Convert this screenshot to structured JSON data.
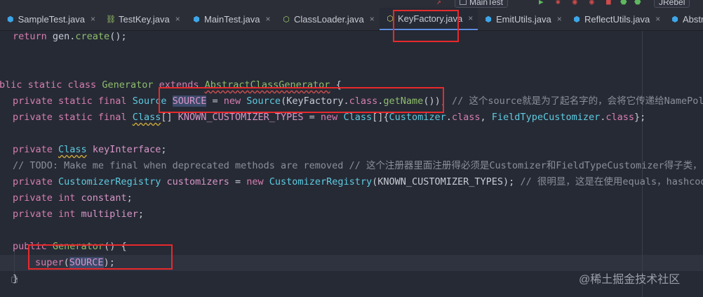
{
  "toolbar": {
    "run_config": "MainTest",
    "jrebel": "JRebel"
  },
  "tabs": [
    {
      "label": "SampleTest.java",
      "icon": "class-icon",
      "active": false
    },
    {
      "label": "TestKey.java",
      "icon": "package-icon",
      "active": false
    },
    {
      "label": "MainTest.java",
      "icon": "class-icon",
      "active": false
    },
    {
      "label": "ClassLoader.java",
      "icon": "interface-icon",
      "active": false
    },
    {
      "label": "KeyFactory.java",
      "icon": "interface-icon",
      "active": true
    },
    {
      "label": "EmitUtils.java",
      "icon": "class-icon",
      "active": false
    },
    {
      "label": "ReflectUtils.java",
      "icon": "class-icon",
      "active": false
    },
    {
      "label": "Abstr",
      "icon": "class-icon",
      "active": false
    }
  ],
  "code": {
    "l1": {
      "kw": "return",
      "rest1": " gen.",
      "fn": "create",
      "rest2": "();"
    },
    "l2": {
      "kw1": "blic static class ",
      "name": "Generator",
      "kw2": " extends ",
      "parent": "AbstractClassGenerator",
      "rest": " {"
    },
    "l3": {
      "kw": "private static final ",
      "type": "Source",
      "sp": " ",
      "field": "SOURCE",
      "eq": " = ",
      "kw_new": "new ",
      "ctor": "Source",
      "p1": "(KeyFactory.",
      "kw_class": "class",
      "dot": ".",
      "fn": "getName",
      "p2": "());",
      "comment": " // 这个source就是为了起名字的，会将它传递给NamePolicy"
    },
    "l4": {
      "kw": "private static final ",
      "type": "Class",
      "br": "[] ",
      "field": "KNOWN_CUSTOMIZER_TYPES",
      "eq": " = ",
      "kw_new": "new ",
      "type2": "Class",
      "br2": "[]{",
      "t3": "Customizer",
      "d1": ".",
      "kw_c1": "class",
      "comma": ", ",
      "t4": "FieldTypeCustomizer",
      "d2": ".",
      "kw_c2": "class",
      "end": "};"
    },
    "l5": {
      "kw": "private ",
      "type": "Class",
      "sp": " ",
      "field": "keyInterface",
      "end": ";"
    },
    "l6": {
      "comment": "// TODO: Make me final when deprecated methods are removed // 这个注册器里面注册得必须是Customizer和FieldTypeCustomizer得子类，"
    },
    "l7": {
      "kw": "private ",
      "type": "CustomizerRegistry",
      "sp": " ",
      "field": "customizers",
      "eq": " = ",
      "kw_new": "new ",
      "ctor": "CustomizerRegistry",
      "args": "(KNOWN_CUSTOMIZER_TYPES);",
      "comment": " // 很明显，这是在使用equals，hashcode,"
    },
    "l8": {
      "kw": "private int ",
      "field": "constant",
      "end": ";"
    },
    "l9": {
      "kw": "private int ",
      "field": "multiplier",
      "end": ";"
    },
    "l10": {
      "kw": "public ",
      "fn": "Generator",
      "rest": "() {"
    },
    "l11": {
      "kw": "super",
      "p1": "(",
      "field": "SOURCE",
      "p2": ");"
    },
    "l12": {
      "brace": "}"
    }
  },
  "watermark": "@稀土掘金技术社区",
  "colors": {
    "background": "#262a35",
    "annotation_box": "#e8292c",
    "keyword": "#d77eb1",
    "type": "#5ecbe0",
    "function": "#8fbe6d",
    "comment": "#8a8f99"
  }
}
